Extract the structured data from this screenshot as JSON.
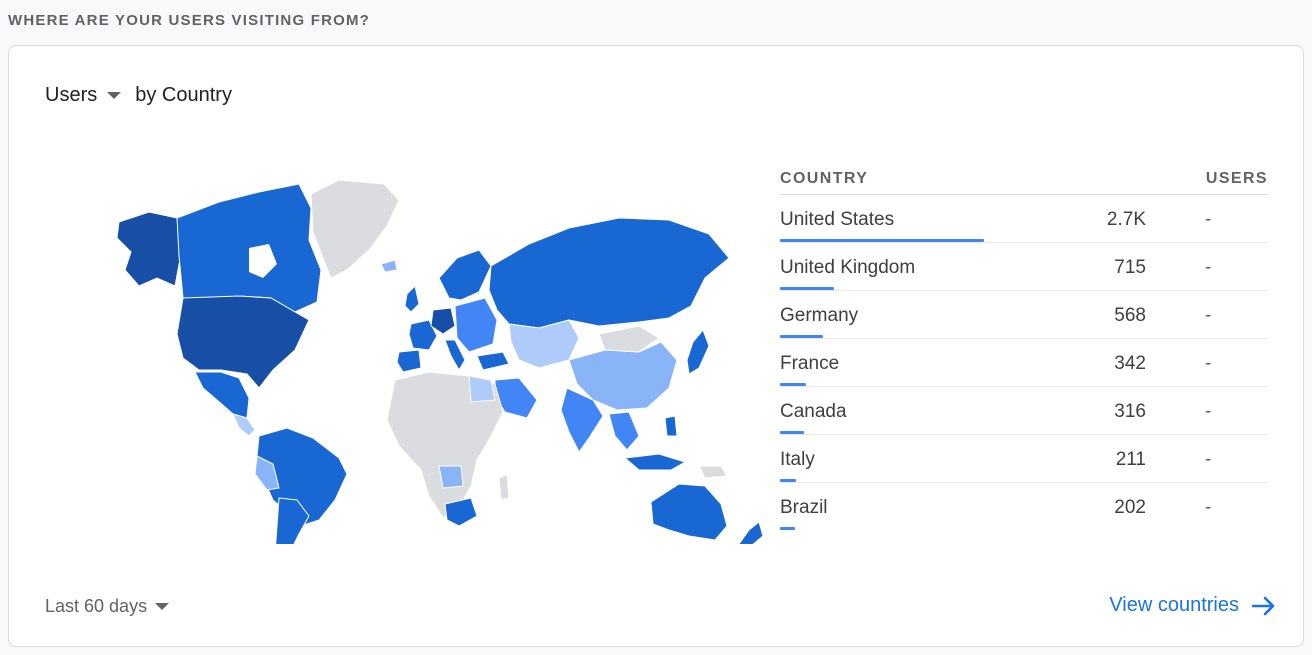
{
  "section": {
    "title": "WHERE ARE YOUR USERS VISITING FROM?"
  },
  "card": {
    "metric_label": "Users",
    "dimension_label": "by Country",
    "date_range": "Last 60 days",
    "view_link": "View countries"
  },
  "table": {
    "col_country": "COUNTRY",
    "col_users": "USERS",
    "rows": [
      {
        "country": "United States",
        "value": "2.7K",
        "change": "-",
        "share": 1.0
      },
      {
        "country": "United Kingdom",
        "value": "715",
        "change": "-",
        "share": 0.265
      },
      {
        "country": "Germany",
        "value": "568",
        "change": "-",
        "share": 0.21
      },
      {
        "country": "France",
        "value": "342",
        "change": "-",
        "share": 0.127
      },
      {
        "country": "Canada",
        "value": "316",
        "change": "-",
        "share": 0.117
      },
      {
        "country": "Italy",
        "value": "211",
        "change": "-",
        "share": 0.078
      },
      {
        "country": "Brazil",
        "value": "202",
        "change": "-",
        "share": 0.075
      }
    ]
  },
  "colors": {
    "accent": "#1a73e8",
    "bar": "#4285f4",
    "map_darkest": "#174ea6",
    "map_dark": "#1967d2",
    "map_mid": "#4285f4",
    "map_light": "#8ab4f8",
    "map_lightest": "#aecbfa",
    "map_nodata": "#dadce0"
  },
  "icons": {
    "metric_caret": "caret-down-icon",
    "range_caret": "caret-down-icon",
    "view_arrow": "arrow-right-icon"
  }
}
